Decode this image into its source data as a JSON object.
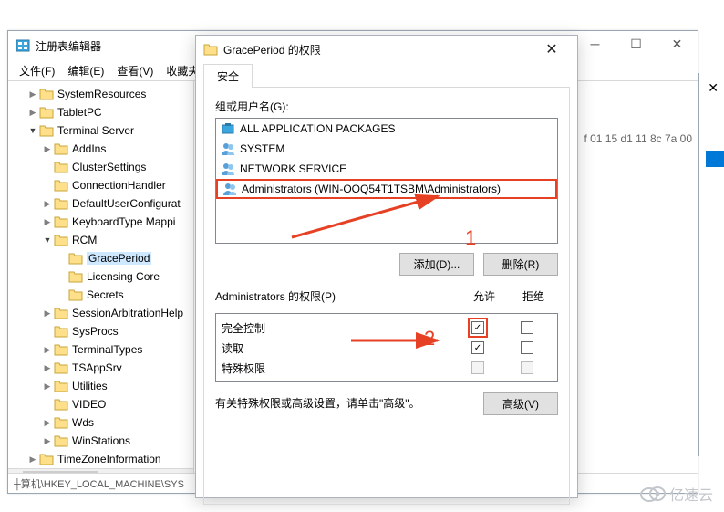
{
  "main_window": {
    "title": "注册表编辑器",
    "menus": [
      "文件(F)",
      "编辑(E)",
      "查看(V)",
      "收藏夹"
    ],
    "status_path": "┼算机\\HKEY_LOCAL_MACHINE\\SYS",
    "hex_fragment": "f 01 15 d1 11 8c 7a 00"
  },
  "tree": {
    "items": [
      {
        "level": 1,
        "arrow": "right",
        "label": "SystemResources"
      },
      {
        "level": 1,
        "arrow": "right",
        "label": "TabletPC"
      },
      {
        "level": 1,
        "arrow": "down",
        "label": "Terminal Server"
      },
      {
        "level": 2,
        "arrow": "right",
        "label": "AddIns"
      },
      {
        "level": 2,
        "arrow": "",
        "label": "ClusterSettings"
      },
      {
        "level": 2,
        "arrow": "",
        "label": "ConnectionHandler"
      },
      {
        "level": 2,
        "arrow": "right",
        "label": "DefaultUserConfigurat"
      },
      {
        "level": 2,
        "arrow": "right",
        "label": "KeyboardType Mappi"
      },
      {
        "level": 2,
        "arrow": "down",
        "label": "RCM"
      },
      {
        "level": 3,
        "arrow": "",
        "label": "GracePeriod",
        "selected": true
      },
      {
        "level": 3,
        "arrow": "",
        "label": "Licensing Core"
      },
      {
        "level": 3,
        "arrow": "",
        "label": "Secrets"
      },
      {
        "level": 2,
        "arrow": "right",
        "label": "SessionArbitrationHelp"
      },
      {
        "level": 2,
        "arrow": "",
        "label": "SysProcs"
      },
      {
        "level": 2,
        "arrow": "right",
        "label": "TerminalTypes"
      },
      {
        "level": 2,
        "arrow": "right",
        "label": "TSAppSrv"
      },
      {
        "level": 2,
        "arrow": "right",
        "label": "Utilities"
      },
      {
        "level": 2,
        "arrow": "",
        "label": "VIDEO"
      },
      {
        "level": 2,
        "arrow": "right",
        "label": "Wds"
      },
      {
        "level": 2,
        "arrow": "right",
        "label": "WinStations"
      },
      {
        "level": 1,
        "arrow": "right",
        "label": "TimeZoneInformation"
      }
    ]
  },
  "dialog": {
    "title": "GracePeriod 的权限",
    "tab": "安全",
    "group_label": "组或用户名(G):",
    "groups": [
      {
        "icon": "package",
        "label": "ALL APPLICATION PACKAGES"
      },
      {
        "icon": "users",
        "label": "SYSTEM"
      },
      {
        "icon": "users",
        "label": "NETWORK SERVICE"
      },
      {
        "icon": "users",
        "label": "Administrators (WIN-OOQ54T1TSBM\\Administrators)",
        "highlight": true
      }
    ],
    "btn_add": "添加(D)...",
    "btn_remove": "删除(R)",
    "perm_label": "Administrators 的权限(P)",
    "col_allow": "允许",
    "col_deny": "拒绝",
    "perms": [
      {
        "name": "完全控制",
        "allow_checked": true,
        "deny_checked": false,
        "allow_boxed": true
      },
      {
        "name": "读取",
        "allow_checked": true,
        "deny_checked": false
      },
      {
        "name": "特殊权限",
        "allow_checked": false,
        "deny_checked": false,
        "disabled": true
      }
    ],
    "hint": "有关特殊权限或高级设置，请单击\"高级\"。",
    "btn_advanced": "高级(V)"
  },
  "annotations": {
    "one": "1",
    "two": "2"
  },
  "watermark": "亿速云"
}
